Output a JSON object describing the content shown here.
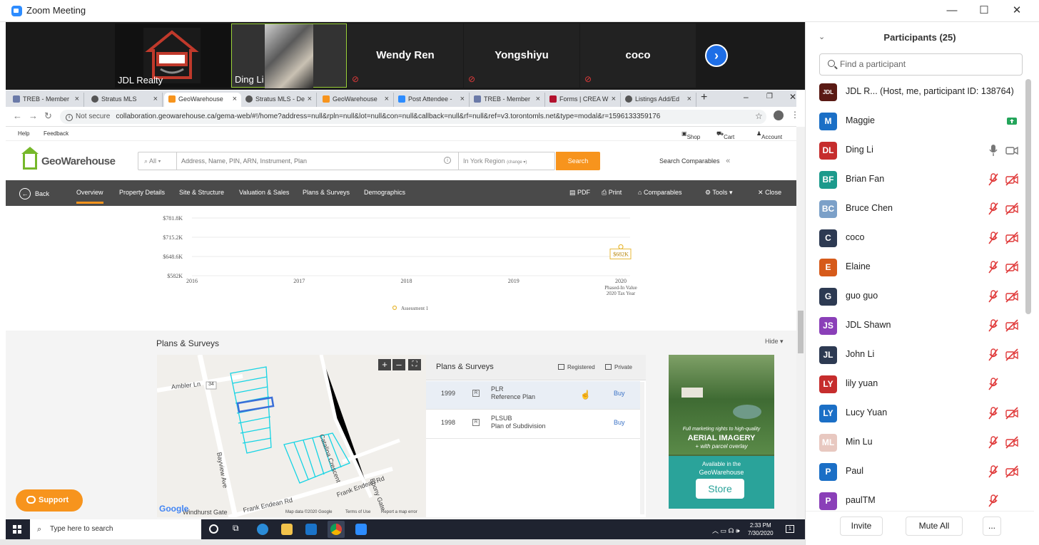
{
  "zoom": {
    "title": "Zoom Meeting",
    "window_controls": [
      "—",
      "☐",
      "✕"
    ]
  },
  "video_tiles": [
    {
      "name": "JDL Realty",
      "type": "logo"
    },
    {
      "name": "Ding Li",
      "type": "video"
    },
    {
      "name": "Wendy Ren",
      "type": "text"
    },
    {
      "name": "Yongshiyu",
      "type": "text"
    },
    {
      "name": "coco",
      "type": "text"
    }
  ],
  "browser": {
    "tabs": [
      {
        "label": "TREB - Member"
      },
      {
        "label": "Stratus MLS"
      },
      {
        "label": "GeoWarehouse",
        "active": true
      },
      {
        "label": "Stratus MLS - De"
      },
      {
        "label": "GeoWarehouse"
      },
      {
        "label": "Post Attendee -"
      },
      {
        "label": "TREB - Member"
      },
      {
        "label": "Forms | CREA W"
      },
      {
        "label": "Listings Add/Ed"
      }
    ],
    "not_secure": "Not secure",
    "url": "collaboration.geowarehouse.ca/gema-web/#!/home?address=null&rpln=null&lot=null&con=null&callback=null&rf=null&ref=v3.torontomls.net&type=modal&r=1596133359176"
  },
  "geowarehouse": {
    "top_links": {
      "help": "Help",
      "feedback": "Feedback",
      "shop": "Shop",
      "cart": "Cart (0)",
      "account": "Account"
    },
    "logo": "GeoWarehouse",
    "search": {
      "scope": "All",
      "placeholder": "Address, Name, PIN, ARN, Instrument, Plan",
      "region": "In York Region",
      "region_change": "(change ▾)",
      "button": "Search",
      "comparables": "Search Comparables"
    },
    "nav": {
      "back": "Back",
      "items": [
        "Overview",
        "Property Details",
        "Site & Structure",
        "Valuation & Sales",
        "Plans & Surveys",
        "Demographics"
      ],
      "actions": [
        "PDF",
        "Print",
        "Comparables",
        "Tools",
        "Close"
      ]
    },
    "plans": {
      "title": "Plans & Surveys",
      "hide": "Hide",
      "panel_title": "Plans & Surveys",
      "registered": "Registered",
      "private": "Private",
      "rows": [
        {
          "year": "1999",
          "marker": "R",
          "code": "PLR",
          "desc": "Reference Plan",
          "buy": "Buy"
        },
        {
          "year": "1998",
          "marker": "R",
          "code": "PLSUB",
          "desc": "Plan of Subdivision",
          "buy": "Buy"
        }
      ]
    },
    "map": {
      "labels": [
        "Ambler Ln",
        "34",
        "Catalina Crescent",
        "Frank Endean Rd",
        "Bayview Ave",
        "Frank Endean Rd",
        "Ebony Gate",
        "Windhurst Gate"
      ],
      "google": "Google",
      "footer": [
        "Map data ©2020 Google",
        "Terms of Use",
        "Report a map error"
      ]
    },
    "ad": {
      "line1": "Full marketing rights to high-quality",
      "line2": "AERIAL IMAGERY",
      "line3": "+ with parcel overlay",
      "line4": "Available in the",
      "line5": "GeoWarehouse",
      "button": "Store"
    },
    "support": "Support"
  },
  "chart_data": {
    "type": "line",
    "x": [
      "2016",
      "2017",
      "2018",
      "2019",
      "2020"
    ],
    "series": [
      {
        "name": "Assessment 1",
        "values": [
          null,
          null,
          null,
          null,
          682
        ]
      }
    ],
    "y_ticks": [
      "$781.8K",
      "$715.2K",
      "$648.6K",
      "$582K"
    ],
    "ylim": [
      582,
      781.8
    ],
    "data_label": "$682K",
    "x_note": [
      "Phased-In Value",
      "2020 Tax Year"
    ],
    "legend_position": "bottom-center",
    "grid": true
  },
  "participants": {
    "title": "Participants (25)",
    "search_placeholder": "Find a participant",
    "list": [
      {
        "initials": "JDL",
        "name": "JDL R...   (Host, me, participant ID: 138764)",
        "color": "#5a1a14",
        "mic": "none",
        "cam": "none"
      },
      {
        "initials": "M",
        "name": "Maggie",
        "color": "#1b6fc6",
        "mic": "share",
        "cam": "none"
      },
      {
        "initials": "DL",
        "name": "Ding Li",
        "color": "#c62d2d",
        "mic": "on",
        "cam": "on"
      },
      {
        "initials": "BF",
        "name": "Brian Fan",
        "color": "#1c9a8c",
        "mic": "muted",
        "cam": "off"
      },
      {
        "initials": "BC",
        "name": "Bruce Chen",
        "color": "#7ba0c8",
        "mic": "muted",
        "cam": "off"
      },
      {
        "initials": "C",
        "name": "coco",
        "color": "#2d3a52",
        "mic": "muted",
        "cam": "off"
      },
      {
        "initials": "E",
        "name": "Elaine",
        "color": "#d65a1a",
        "mic": "muted",
        "cam": "off"
      },
      {
        "initials": "G",
        "name": "guo guo",
        "color": "#2d3a52",
        "mic": "muted",
        "cam": "off"
      },
      {
        "initials": "JS",
        "name": "JDL Shawn",
        "color": "#8a3fb8",
        "mic": "muted",
        "cam": "off"
      },
      {
        "initials": "JL",
        "name": "John Li",
        "color": "#2d3a52",
        "mic": "muted",
        "cam": "off"
      },
      {
        "initials": "LY",
        "name": "lily yuan",
        "color": "#c62d2d",
        "mic": "muted",
        "cam": "none"
      },
      {
        "initials": "LY",
        "name": "Lucy Yuan",
        "color": "#1b6fc6",
        "mic": "muted",
        "cam": "off"
      },
      {
        "initials": "ML",
        "name": "Min Lu",
        "color": "#e8c8c0",
        "mic": "muted",
        "cam": "off"
      },
      {
        "initials": "P",
        "name": "Paul",
        "color": "#1b6fc6",
        "mic": "muted",
        "cam": "off"
      },
      {
        "initials": "P",
        "name": "paulTM",
        "color": "#8a3fb8",
        "mic": "muted",
        "cam": "none"
      }
    ],
    "footer": {
      "invite": "Invite",
      "mute_all": "Mute All",
      "more": "..."
    }
  },
  "taskbar": {
    "search_placeholder": "Type here to search",
    "time": "2:33 PM",
    "date": "7/30/2020"
  },
  "colors": {
    "zoom_blue": "#2d8cff",
    "geo_green": "#76b82a",
    "geo_orange": "#f7941d",
    "nav_dark": "#4a4a4a",
    "muted_red": "#e03a3a"
  }
}
